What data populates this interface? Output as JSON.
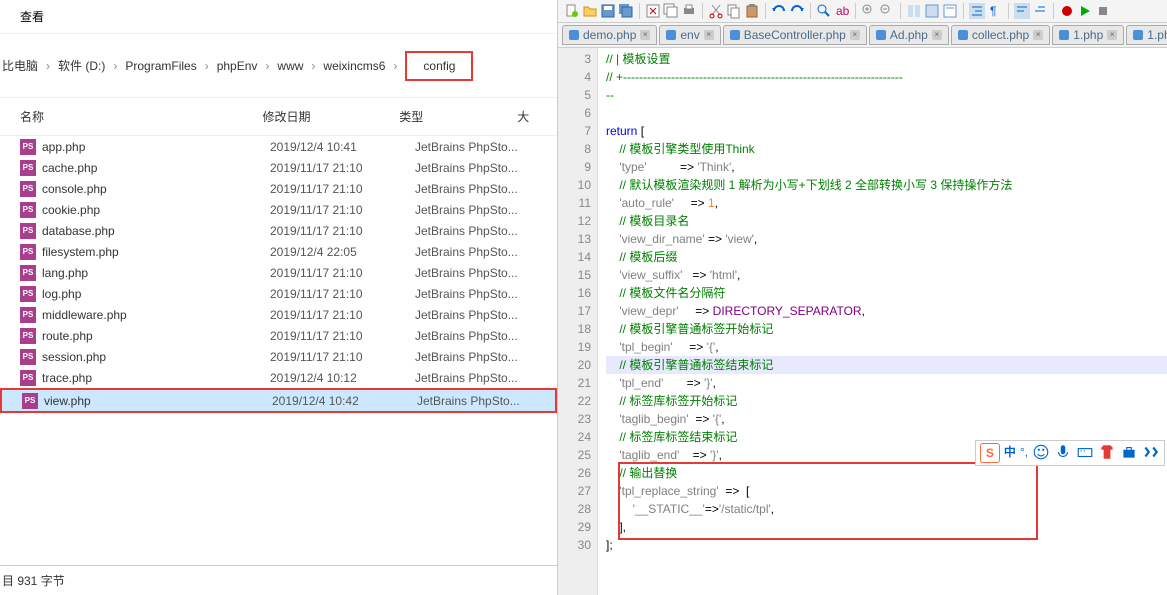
{
  "menu": {
    "view": "查看"
  },
  "breadcrumb": {
    "items": [
      "比电脑",
      "软件 (D:)",
      "ProgramFiles",
      "phpEnv",
      "www",
      "weixincms6"
    ],
    "highlight": "config"
  },
  "headers": {
    "name": "名称",
    "date": "修改日期",
    "type": "类型",
    "size": "大"
  },
  "files": [
    {
      "name": "app.php",
      "date": "2019/12/4 10:41",
      "type": "JetBrains PhpSto..."
    },
    {
      "name": "cache.php",
      "date": "2019/11/17 21:10",
      "type": "JetBrains PhpSto..."
    },
    {
      "name": "console.php",
      "date": "2019/11/17 21:10",
      "type": "JetBrains PhpSto..."
    },
    {
      "name": "cookie.php",
      "date": "2019/11/17 21:10",
      "type": "JetBrains PhpSto..."
    },
    {
      "name": "database.php",
      "date": "2019/11/17 21:10",
      "type": "JetBrains PhpSto..."
    },
    {
      "name": "filesystem.php",
      "date": "2019/12/4 22:05",
      "type": "JetBrains PhpSto..."
    },
    {
      "name": "lang.php",
      "date": "2019/11/17 21:10",
      "type": "JetBrains PhpSto..."
    },
    {
      "name": "log.php",
      "date": "2019/11/17 21:10",
      "type": "JetBrains PhpSto..."
    },
    {
      "name": "middleware.php",
      "date": "2019/11/17 21:10",
      "type": "JetBrains PhpSto..."
    },
    {
      "name": "route.php",
      "date": "2019/11/17 21:10",
      "type": "JetBrains PhpSto..."
    },
    {
      "name": "session.php",
      "date": "2019/11/17 21:10",
      "type": "JetBrains PhpSto..."
    },
    {
      "name": "trace.php",
      "date": "2019/12/4 10:12",
      "type": "JetBrains PhpSto..."
    },
    {
      "name": "view.php",
      "date": "2019/12/4 10:42",
      "type": "JetBrains PhpSto..."
    }
  ],
  "status": "目  931 字节",
  "tabs": [
    "demo.php",
    "env",
    "BaseController.php",
    "Ad.php",
    "collect.php",
    "1.php",
    "1.ph"
  ],
  "lines": {
    "start": 3,
    "end": 30
  },
  "code": {
    "l3": "// | 模板设置",
    "l4": "// +----------------------------------------------------------------------",
    "l5": "--",
    "l6": "",
    "l7a": "return",
    "l7b": " [",
    "l8": "    // 模板引擎类型使用Think",
    "l9a": "    'type'          ",
    "l9b": "=> ",
    "l9c": "'Think'",
    "l9d": ",",
    "l10": "    // 默认模板渲染规则 1 解析为小写+下划线 2 全部转换小写 3 保持操作方法",
    "l11a": "    'auto_rule'     ",
    "l11b": "=> ",
    "l11c": "1",
    "l11d": ",",
    "l12": "    // 模板目录名",
    "l13a": "    'view_dir_name' ",
    "l13b": "=> ",
    "l13c": "'view'",
    "l13d": ",",
    "l14": "    // 模板后缀",
    "l15a": "    'view_suffix'   ",
    "l15b": "=> ",
    "l15c": "'html'",
    "l15d": ",",
    "l16": "    // 模板文件名分隔符",
    "l17a": "    'view_depr'     ",
    "l17b": "=> ",
    "l17c": "DIRECTORY_SEPARATOR",
    "l17d": ",",
    "l18": "    // 模板引擎普通标签开始标记",
    "l19a": "    'tpl_begin'     ",
    "l19b": "=> ",
    "l19c": "'{'",
    "l19d": ",",
    "l20": "    // 模板引擎普通标签结束标记",
    "l21a": "    'tpl_end'       ",
    "l21b": "=> ",
    "l21c": "'}'",
    "l21d": ",",
    "l22": "    // 标签库标签开始标记",
    "l23a": "    'taglib_begin'  ",
    "l23b": "=> ",
    "l23c": "'{'",
    "l23d": ",",
    "l24": "    // 标签库标签结束标记",
    "l25a": "    'taglib_end'    ",
    "l25b": "=> ",
    "l25c": "'}'",
    "l25d": ",",
    "l26": "    // 输出替换",
    "l27a": "    'tpl_replace_string'  ",
    "l27b": "=>  [",
    "l28a": "        '__STATIC__'",
    "l28b": "=>",
    "l28c": "'/static/tpl'",
    "l28d": ",",
    "l29": "    ],",
    "l30": "];"
  },
  "sogou": {
    "label": "S",
    "zhong": "中"
  }
}
